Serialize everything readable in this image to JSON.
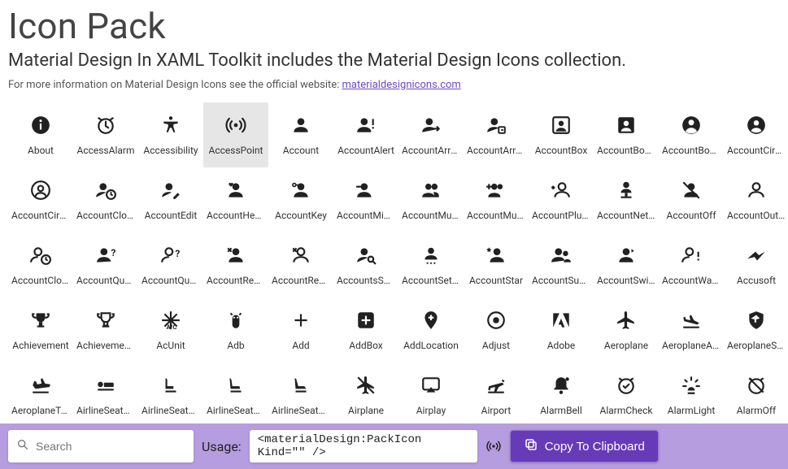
{
  "header": {
    "title": "Icon Pack",
    "subtitle": "Material Design In XAML Toolkit includes the Material Design Icons collection.",
    "info_text": "For more information on Material Design Icons see the official website: ",
    "info_link": "materialdesignicons.com"
  },
  "grid": {
    "selected_index": 3,
    "icons": [
      {
        "name": "About",
        "icon": "info"
      },
      {
        "name": "AccessAlarm",
        "icon": "alarm"
      },
      {
        "name": "Accessibility",
        "icon": "accessibility"
      },
      {
        "name": "AccessPoint",
        "icon": "accesspoint"
      },
      {
        "name": "Account",
        "icon": "account"
      },
      {
        "name": "AccountAlert",
        "icon": "account-alert"
      },
      {
        "name": "AccountArrowRight",
        "icon": "account-arrow"
      },
      {
        "name": "AccountArrowRightOutline",
        "icon": "account-box-arrow"
      },
      {
        "name": "AccountBox",
        "icon": "account-box-o"
      },
      {
        "name": "AccountBoxMultiple",
        "icon": "account-box"
      },
      {
        "name": "AccountBoxOutline",
        "icon": "account-circle-b"
      },
      {
        "name": "AccountCircle",
        "icon": "account-circle"
      },
      {
        "name": "AccountCircleOutline",
        "icon": "account-circle-o"
      },
      {
        "name": "AccountClock",
        "icon": "account-clock"
      },
      {
        "name": "AccountEdit",
        "icon": "account-edit"
      },
      {
        "name": "AccountHeart",
        "icon": "account-heart"
      },
      {
        "name": "AccountKey",
        "icon": "account-key"
      },
      {
        "name": "AccountMinus",
        "icon": "account-minus"
      },
      {
        "name": "AccountMultiple",
        "icon": "account-multiple"
      },
      {
        "name": "AccountMultiplePlus",
        "icon": "account-multiple-plus"
      },
      {
        "name": "AccountPlusOutline",
        "icon": "account-plus-o"
      },
      {
        "name": "AccountNetwork",
        "icon": "account-network"
      },
      {
        "name": "AccountOff",
        "icon": "account-off"
      },
      {
        "name": "AccountOutline",
        "icon": "account-outline"
      },
      {
        "name": "AccountClockOutline",
        "icon": "account-clock-o"
      },
      {
        "name": "AccountQuestion",
        "icon": "account-question"
      },
      {
        "name": "AccountQuestionOutline",
        "icon": "account-question-o"
      },
      {
        "name": "AccountRemove",
        "icon": "account-remove"
      },
      {
        "name": "AccountRemoveOutline",
        "icon": "account-remove-o"
      },
      {
        "name": "AccountsSearch",
        "icon": "account-search"
      },
      {
        "name": "AccountSettings",
        "icon": "account-settings"
      },
      {
        "name": "AccountStar",
        "icon": "account-star"
      },
      {
        "name": "AccountSupervisor",
        "icon": "account-supervisor"
      },
      {
        "name": "AccountSwitch",
        "icon": "account-switch"
      },
      {
        "name": "AccountWarning",
        "icon": "account-warning"
      },
      {
        "name": "Accusoft",
        "icon": "accusoft"
      },
      {
        "name": "Achievement",
        "icon": "trophy"
      },
      {
        "name": "AchievementOutline",
        "icon": "trophy-o"
      },
      {
        "name": "AcUnit",
        "icon": "acunit"
      },
      {
        "name": "Adb",
        "icon": "adb"
      },
      {
        "name": "Add",
        "icon": "plus"
      },
      {
        "name": "AddBox",
        "icon": "plus-box"
      },
      {
        "name": "AddLocation",
        "icon": "map-plus"
      },
      {
        "name": "Adjust",
        "icon": "adjust"
      },
      {
        "name": "Adobe",
        "icon": "adobe"
      },
      {
        "name": "Aeroplane",
        "icon": "airplane"
      },
      {
        "name": "AeroplaneArriving",
        "icon": "airplane-landing"
      },
      {
        "name": "AeroplaneShield",
        "icon": "airplane-shield"
      },
      {
        "name": "AeroplaneTakeoff",
        "icon": "airplane-takeoff"
      },
      {
        "name": "AirlineSeatFlat",
        "icon": "seat-flat"
      },
      {
        "name": "AirlineSeatRecline",
        "icon": "seat-recline1"
      },
      {
        "name": "AirlineSeatExtra",
        "icon": "seat-recline2"
      },
      {
        "name": "AirlineSeatNormal",
        "icon": "seat-recline3"
      },
      {
        "name": "Airplane",
        "icon": "airplane-off"
      },
      {
        "name": "Airplay",
        "icon": "airplay"
      },
      {
        "name": "Airport",
        "icon": "airport"
      },
      {
        "name": "AlarmBell",
        "icon": "alarm-bell"
      },
      {
        "name": "AlarmCheck",
        "icon": "alarm-check"
      },
      {
        "name": "AlarmLight",
        "icon": "alarm-light"
      },
      {
        "name": "AlarmOff",
        "icon": "alarm-off"
      }
    ]
  },
  "footer": {
    "search_placeholder": "Search",
    "usage_label": "Usage:",
    "usage_value": "<materialDesign:PackIcon Kind=\"\" />",
    "copy_label": "Copy To Clipboard"
  }
}
